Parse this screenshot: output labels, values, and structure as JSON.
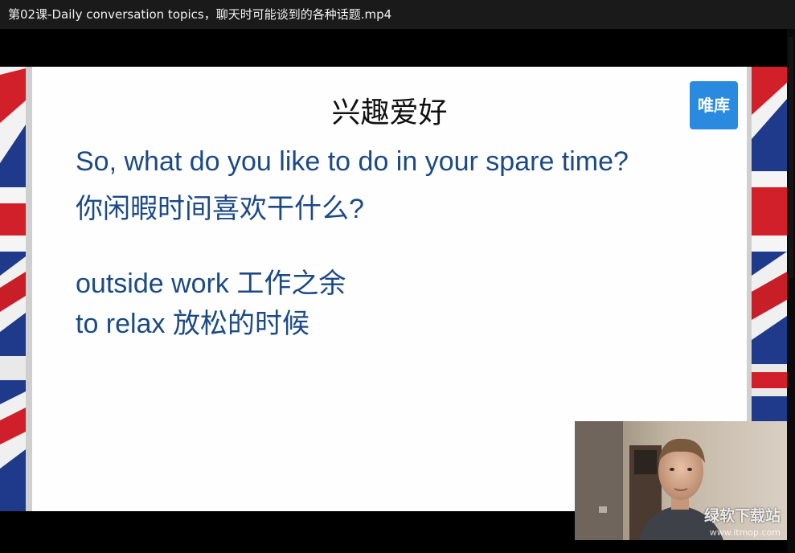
{
  "window": {
    "title": "第02课-Daily conversation topics，聊天时可能谈到的各种话题.mp4"
  },
  "slide": {
    "heading": "兴趣爱好",
    "logo_text": "唯库",
    "lines": [
      "So, what do you like to do in your spare time?",
      "你闲暇时间喜欢干什么?",
      "outside work 工作之余",
      "to relax 放松的时候"
    ],
    "text_color": "#1c4a86"
  },
  "watermark": {
    "brand": "绿软下载站",
    "url": "www.itmop.com"
  }
}
